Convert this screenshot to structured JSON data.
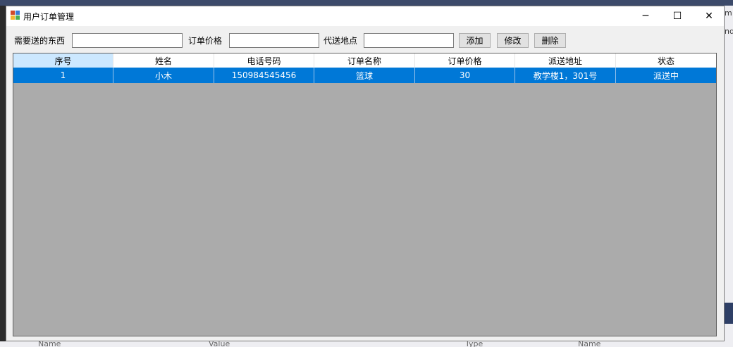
{
  "window": {
    "title": "用户订单管理",
    "minimize_glyph": "─",
    "maximize_glyph": "☐",
    "close_glyph": "✕"
  },
  "form": {
    "item_label": "需要送的东西",
    "item_value": "",
    "price_label": "订单价格",
    "price_value": "",
    "address_label": "代送地点",
    "address_value": "",
    "add_button": "添加",
    "edit_button": "修改",
    "delete_button": "删除"
  },
  "grid": {
    "columns": [
      "序号",
      "姓名",
      "电话号码",
      "订单名称",
      "订单价格",
      "派送地址",
      "状态"
    ],
    "rows": [
      [
        "1",
        "小木",
        "15098454545​6",
        "篮球",
        "30",
        "教学楼1，301号",
        "派送中"
      ]
    ]
  },
  "background": {
    "right_frag_1": "m",
    "right_frag_2": "nd",
    "bottom_labels": [
      "Name",
      "Value",
      "Type",
      "Name"
    ]
  },
  "colors": {
    "selection": "#0078d7",
    "grid_bg": "#ababab",
    "selected_header": "#cce8ff"
  }
}
